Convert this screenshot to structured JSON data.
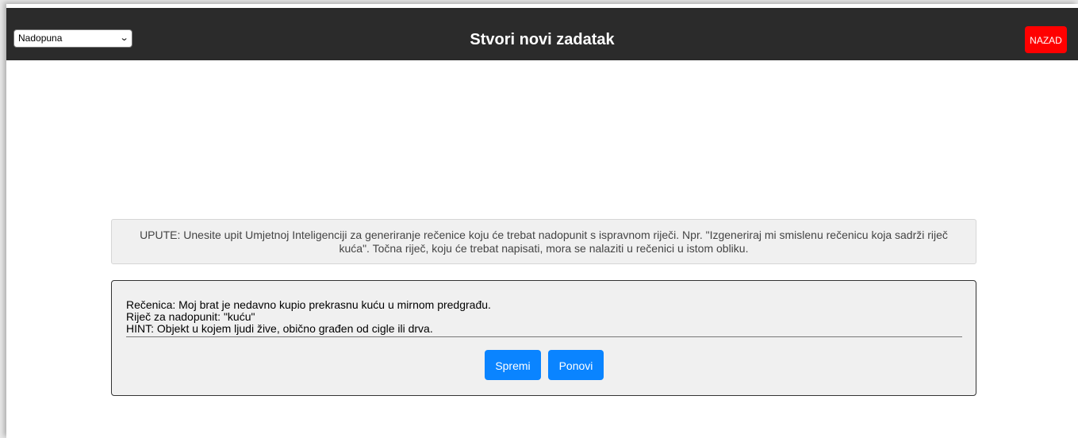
{
  "header": {
    "mode_select_value": "Nadopuna",
    "title": "Stvori novi zadatak",
    "back_label": "NAZAD"
  },
  "instructions": {
    "text": "UPUTE: Unesite upit Umjetnoj Inteligenciji za generiranje rečenice koju će trebat nadopunit s ispravnom riječi. Npr. \"Izgeneriraj mi smislenu rečenicu koja sadrži riječ kuća\". Točna riječ, koju će trebat napisati, mora se nalaziti u rečenici u istom obliku."
  },
  "result": {
    "sentence_line": "Rečenica: Moj brat je nedavno kupio prekrasnu kuću u mirnom predgrađu.",
    "word_line": "Riječ za nadopunit: \"kuću\"",
    "hint_line": "HINT: Objekt u kojem ljudi žive, obično građen od cigle ili drva."
  },
  "actions": {
    "save_label": "Spremi",
    "retry_label": "Ponovi"
  },
  "colors": {
    "topbar": "#2b2b2b",
    "back_button": "#ff0000",
    "primary_button": "#0a84ff"
  }
}
